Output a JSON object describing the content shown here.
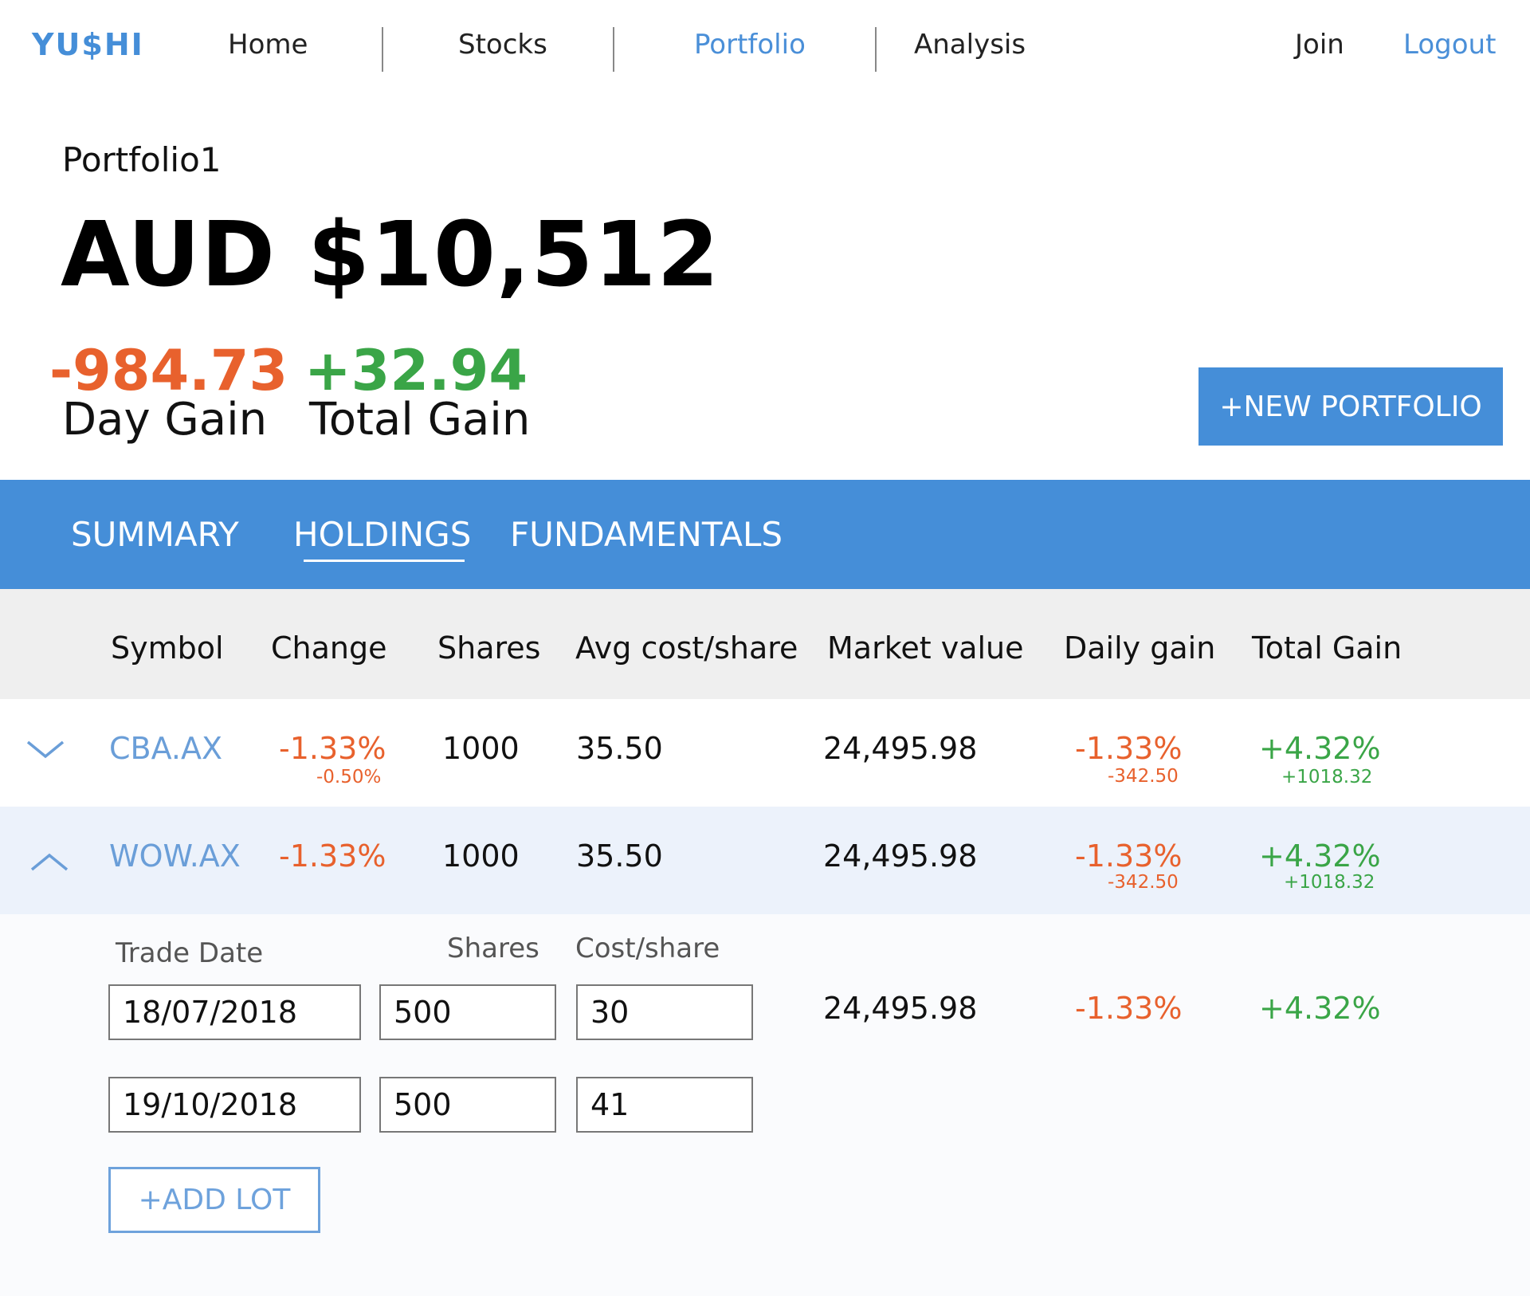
{
  "nav": {
    "logo": "YU$HI",
    "home": "Home",
    "stocks": "Stocks",
    "portfolio": "Portfolio",
    "analysis": "Analysis",
    "join": "Join",
    "logout": "Logout"
  },
  "colors": {
    "brand_blue": "#458ed8",
    "negative": "#e8612d",
    "positive": "#3aa547",
    "link_blue": "#6a9ed8"
  },
  "header": {
    "portfolio_name": "Portfolio1",
    "total_value": "AUD $10,512",
    "day_gain_value": "-984.73",
    "day_gain_label": "Day Gain",
    "total_gain_value": "+32.94",
    "total_gain_label": "Total Gain",
    "new_portfolio_button": "+NEW PORTFOLIO"
  },
  "tabs": {
    "summary": "SUMMARY",
    "holdings": "HOLDINGS",
    "fundamentals": "FUNDAMENTALS",
    "active": "HOLDINGS"
  },
  "table": {
    "headers": {
      "symbol": "Symbol",
      "change": "Change",
      "shares": "Shares",
      "avg_cost": "Avg cost/share",
      "market_value": "Market value",
      "daily_gain": "Daily gain",
      "total_gain": "Total Gain"
    },
    "rows": [
      {
        "expand_icon": "chevron-down-icon",
        "symbol": "CBA.AX",
        "change": "-1.33%",
        "change_sub": "-0.50%",
        "shares": "1000",
        "avg_cost": "35.50",
        "market_value": "24,495.98",
        "daily_gain": "-1.33%",
        "daily_gain_sub": "-342.50",
        "total_gain": "+4.32%",
        "total_gain_sub": "+1018.32"
      },
      {
        "expand_icon": "chevron-up-icon",
        "symbol": "WOW.AX",
        "change": "-1.33%",
        "shares": "1000",
        "avg_cost": "35.50",
        "market_value": "24,495.98",
        "daily_gain": "-1.33%",
        "daily_gain_sub": "-342.50",
        "total_gain": "+4.32%",
        "total_gain_sub": "+1018.32"
      }
    ]
  },
  "lots": {
    "labels": {
      "trade_date": "Trade Date",
      "shares": "Shares",
      "cost_per_share": "Cost/share"
    },
    "items": [
      {
        "trade_date": "18/07/2018",
        "shares": "500",
        "cost": "30",
        "market_value": "24,495.98",
        "daily_gain": "-1.33%",
        "total_gain": "+4.32%"
      },
      {
        "trade_date": "19/10/2018",
        "shares": "500",
        "cost": "41"
      }
    ],
    "add_lot_button": "+ADD LOT"
  }
}
